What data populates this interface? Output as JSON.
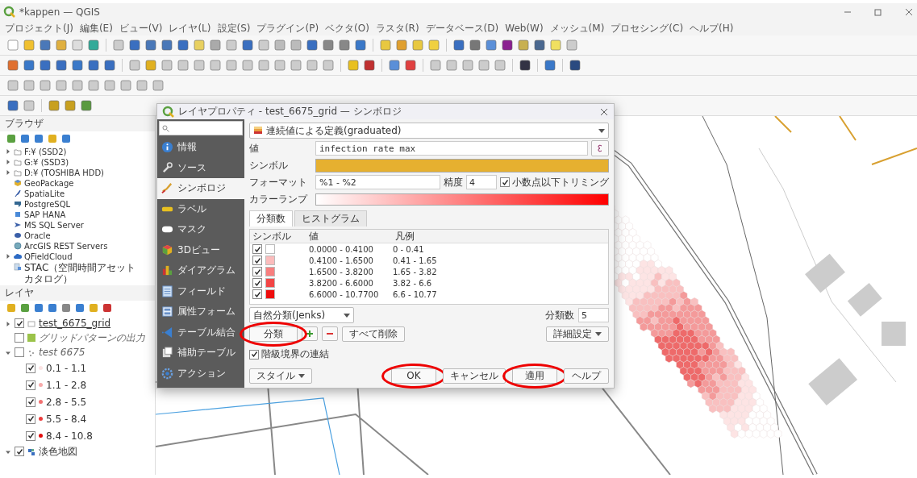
{
  "window": {
    "title": "*kappen — QGIS"
  },
  "menu": [
    "プロジェクト(J)",
    "編集(E)",
    "ビュー(V)",
    "レイヤ(L)",
    "設定(S)",
    "プラグイン(P)",
    "ベクタ(O)",
    "ラスタ(R)",
    "データベース(D)",
    "Web(W)",
    "メッシュ(M)",
    "プロセシング(C)",
    "ヘルプ(H)"
  ],
  "browser_panel": {
    "title": "ブラウザ",
    "items": [
      {
        "label": "F:¥ (SSD2)",
        "kind": "folder",
        "has_children": true
      },
      {
        "label": "G:¥ (SSD3)",
        "kind": "folder",
        "has_children": true
      },
      {
        "label": "D:¥ (TOSHIBA HDD)",
        "kind": "folder",
        "has_children": true
      },
      {
        "label": "GeoPackage",
        "kind": "geopackage",
        "has_children": false
      },
      {
        "label": "SpatiaLite",
        "kind": "feather",
        "has_children": false
      },
      {
        "label": "PostgreSQL",
        "kind": "elephant",
        "has_children": false
      },
      {
        "label": "SAP HANA",
        "kind": "square",
        "has_children": false
      },
      {
        "label": "MS SQL Server",
        "kind": "server",
        "has_children": false
      },
      {
        "label": "Oracle",
        "kind": "database",
        "has_children": false
      },
      {
        "label": "ArcGIS REST Servers",
        "kind": "globe",
        "has_children": false
      },
      {
        "label": "QFieldCloud",
        "kind": "cloud",
        "has_children": true
      },
      {
        "label": "STAC（空間時間アセットカタログ）",
        "kind": "stac",
        "has_children": false
      }
    ]
  },
  "layers_panel": {
    "title": "レイヤ",
    "layers": [
      {
        "label": "test_6675_grid",
        "checked": true,
        "expanded": false,
        "has_children": true,
        "kind": "grid"
      },
      {
        "label": "グリッドパターンの出力",
        "checked": false,
        "has_children": false,
        "kind": "swatch",
        "color": "#9bc34a"
      },
      {
        "label": "test 6675",
        "checked": false,
        "expanded": true,
        "has_children": true,
        "kind": "points",
        "children": [
          {
            "label": "0.1 - 1.1",
            "checked": true,
            "color": "#fbe3e3"
          },
          {
            "label": "1.1 - 2.8",
            "checked": true,
            "color": "#f7a9a9"
          },
          {
            "label": "2.8 - 5.5",
            "checked": true,
            "color": "#f27070"
          },
          {
            "label": "5.5 - 8.4",
            "checked": true,
            "color": "#ec3b3b"
          },
          {
            "label": "8.4 - 10.8",
            "checked": true,
            "color": "#e30d0d"
          }
        ]
      },
      {
        "label": "淡色地図",
        "checked": true,
        "expanded": true,
        "has_children": true,
        "kind": "tiles"
      }
    ]
  },
  "dialog": {
    "title": "レイヤプロパティ - test_6675_grid — シンボロジ",
    "sidebar": [
      {
        "label": "情報",
        "selected": false
      },
      {
        "label": "ソース",
        "selected": false
      },
      {
        "label": "シンボロジ",
        "selected": true
      },
      {
        "label": "ラベル",
        "selected": false
      },
      {
        "label": "マスク",
        "selected": false
      },
      {
        "label": "3Dビュー",
        "selected": false
      },
      {
        "label": "ダイアグラム",
        "selected": false
      },
      {
        "label": "フィールド",
        "selected": false
      },
      {
        "label": "属性フォーム",
        "selected": false
      },
      {
        "label": "テーブル結合",
        "selected": false
      },
      {
        "label": "補助テーブル",
        "selected": false
      },
      {
        "label": "アクション",
        "selected": false
      }
    ],
    "renderer": "連続値による定義(graduated)",
    "value_label": "値",
    "value": "infection rate max",
    "symbol_label": "シンボル",
    "format_label": "フォーマット",
    "format": "%1 - %2",
    "precision_label": "精度",
    "precision": "4",
    "trim": {
      "label": "小数点以下トリミング",
      "checked": true
    },
    "ramp_label": "カラーランプ",
    "tabs": [
      {
        "label": "分類数",
        "selected": true
      },
      {
        "label": "ヒストグラム",
        "selected": false
      }
    ],
    "table": {
      "columns": [
        "シンボル",
        "値",
        "凡例"
      ],
      "rows": [
        {
          "checked": true,
          "color": "#ffffff",
          "value": "0.0000 - 0.4100",
          "legend": "0 - 0.41"
        },
        {
          "checked": true,
          "color": "#fbbcbc",
          "value": "0.4100 - 1.6500",
          "legend": "0.41 - 1.65"
        },
        {
          "checked": true,
          "color": "#f77f7f",
          "value": "1.6500 - 3.8200",
          "legend": "1.65 - 3.82"
        },
        {
          "checked": true,
          "color": "#f24545",
          "value": "3.8200 - 6.6000",
          "legend": "3.82 - 6.6"
        },
        {
          "checked": true,
          "color": "#ee0d0d",
          "value": "6.6000 - 10.7700",
          "legend": "6.6 - 10.77"
        }
      ]
    },
    "mode": "自然分類(Jenks)",
    "classes_label": "分類数",
    "classes": "5",
    "classify": {
      "label": "分類",
      "highlighted": true
    },
    "delete_all": "すべて削除",
    "advanced": "詳細設定",
    "link_bounds": {
      "label": "階級境界の連結",
      "checked": true
    },
    "style_button": "スタイル",
    "buttons": [
      {
        "label": "OK",
        "highlighted": true
      },
      {
        "label": "キャンセル",
        "highlighted": false
      },
      {
        "label": "適用",
        "highlighted": true
      },
      {
        "label": "ヘルプ",
        "highlighted": false
      }
    ]
  }
}
